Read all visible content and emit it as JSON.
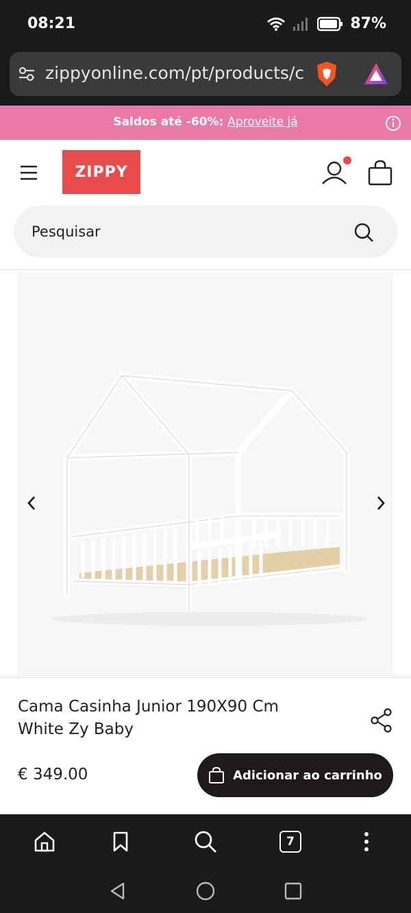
{
  "status_bar": {
    "time": "08:21",
    "battery": "87%"
  },
  "browser": {
    "url": "zippyonline.com/pt/products/c"
  },
  "promo": {
    "text": "Saldos até -60%:",
    "link": "Aproveite já"
  },
  "header": {
    "logo": "ZIPPY"
  },
  "search": {
    "placeholder": "Pesquisar"
  },
  "product": {
    "title": "Cama Casinha Junior 190X90 Cm White Zy Baby",
    "price": "€ 349.00",
    "add_to_cart": "Adicionar ao carrinho"
  },
  "browser_nav": {
    "tab_count": "7"
  },
  "colors": {
    "promo": "#e97aa7",
    "logo": "#e84b4a",
    "button": "#1e1a1a"
  }
}
